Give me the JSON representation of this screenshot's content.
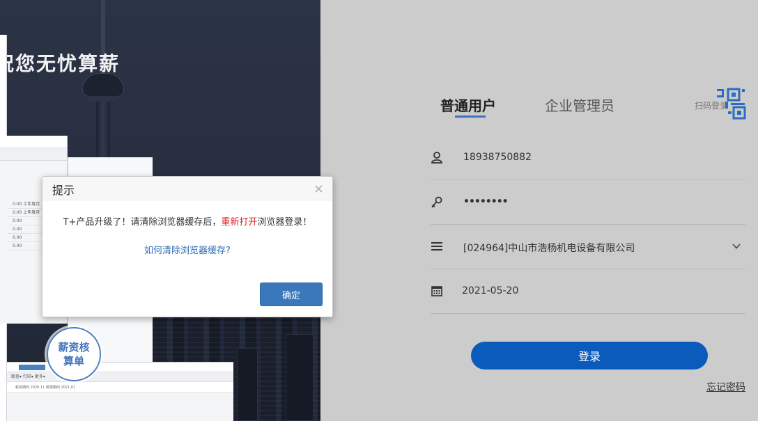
{
  "promo": {
    "title": "祝您无忧算薪",
    "badge": "薪资核算单",
    "mock_rows": [
      "0.00  上年度月",
      "0.00  上年度月",
      "0.00",
      "0.00",
      "0.00",
      "0.00"
    ],
    "mock_bottom_toolbar": "联查▾   打印▾   更多▾",
    "mock_bottom_filter": "薪资期间 2020.11          核报期间 2021.01"
  },
  "tabs": {
    "user": "普通用户",
    "admin": "企业管理员",
    "qr_label": "扫码登录"
  },
  "form": {
    "phone": "18938750882",
    "password": "••••••••",
    "company": "[024964]中山市浩杨机电设备有限公司",
    "date": "2021-05-20"
  },
  "login_button": "登录",
  "forgot_link": "忘记密码",
  "modal": {
    "title": "提示",
    "close": "×",
    "message_before": "T+产品升级了！请清除浏览器缓存后，",
    "message_red": "重新打开",
    "message_after": "浏览器登录！",
    "link": "如何清除浏览器缓存?",
    "ok": "确定"
  },
  "colors": {
    "accent": "#0b5bbd",
    "tab_underline": "#3f72b8",
    "warning_red": "#e02020",
    "link_blue": "#2d6db5"
  }
}
